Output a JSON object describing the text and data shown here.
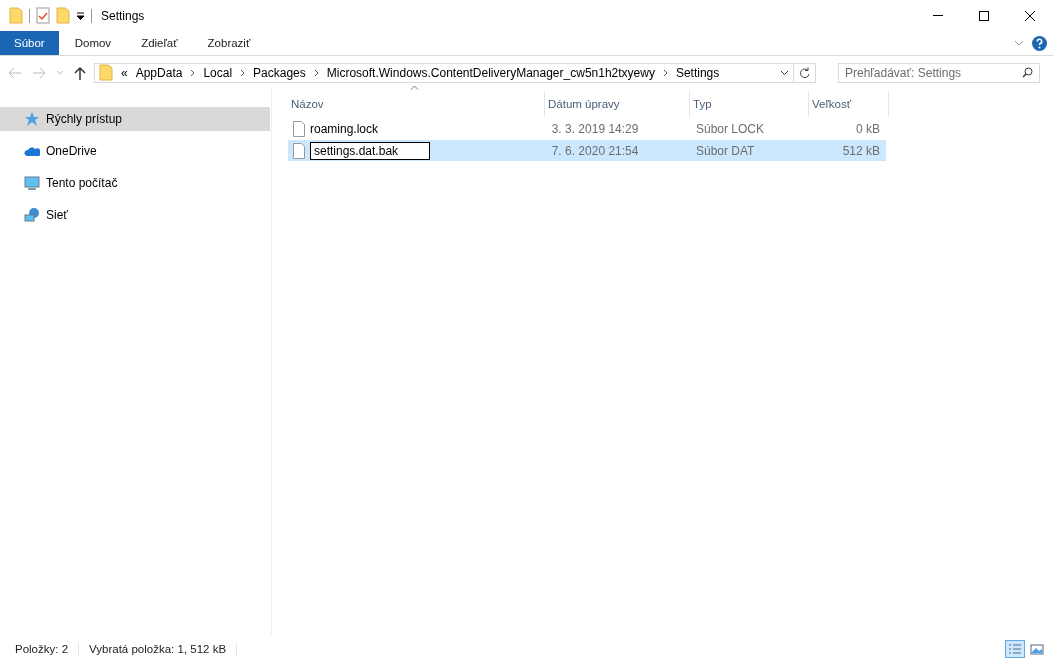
{
  "window": {
    "title": "Settings"
  },
  "ribbon_tabs": [
    {
      "label": "Súbor",
      "selected": true
    },
    {
      "label": "Domov",
      "selected": false
    },
    {
      "label": "Zdieľať",
      "selected": false
    },
    {
      "label": "Zobraziť",
      "selected": false
    }
  ],
  "address": {
    "overflow": "«",
    "breadcrumbs": [
      "AppData",
      "Local",
      "Packages",
      "Microsoft.Windows.ContentDeliveryManager_cw5n1h2txyewy",
      "Settings"
    ]
  },
  "search": {
    "placeholder": "Prehľadávať: Settings"
  },
  "sidebar": {
    "items": [
      {
        "label": "Rýchly prístup",
        "kind": "star",
        "selected": true
      },
      {
        "label": "OneDrive",
        "kind": "cloud",
        "selected": false
      },
      {
        "label": "Tento počítač",
        "kind": "computer",
        "selected": false
      },
      {
        "label": "Sieť",
        "kind": "network",
        "selected": false
      }
    ]
  },
  "table": {
    "columns": [
      "Názov",
      "Dátum úpravy",
      "Typ",
      "Veľkosť"
    ],
    "rows": [
      {
        "name": "roaming.lock",
        "date": "3. 3. 2019 14:29",
        "type": "Súbor LOCK",
        "size": "0 kB",
        "selected": false,
        "editing": false
      },
      {
        "name": "settings.dat.bak",
        "date": "7. 6. 2020 21:54",
        "type": "Súbor DAT",
        "size": "512 kB",
        "selected": true,
        "editing": true
      }
    ]
  },
  "status_bar": {
    "items": "Položky: 2",
    "selection": "Vybratá položka: 1, 512 kB",
    "views": [
      {
        "kind": "details",
        "selected": true
      },
      {
        "kind": "tiles",
        "selected": false
      }
    ]
  }
}
